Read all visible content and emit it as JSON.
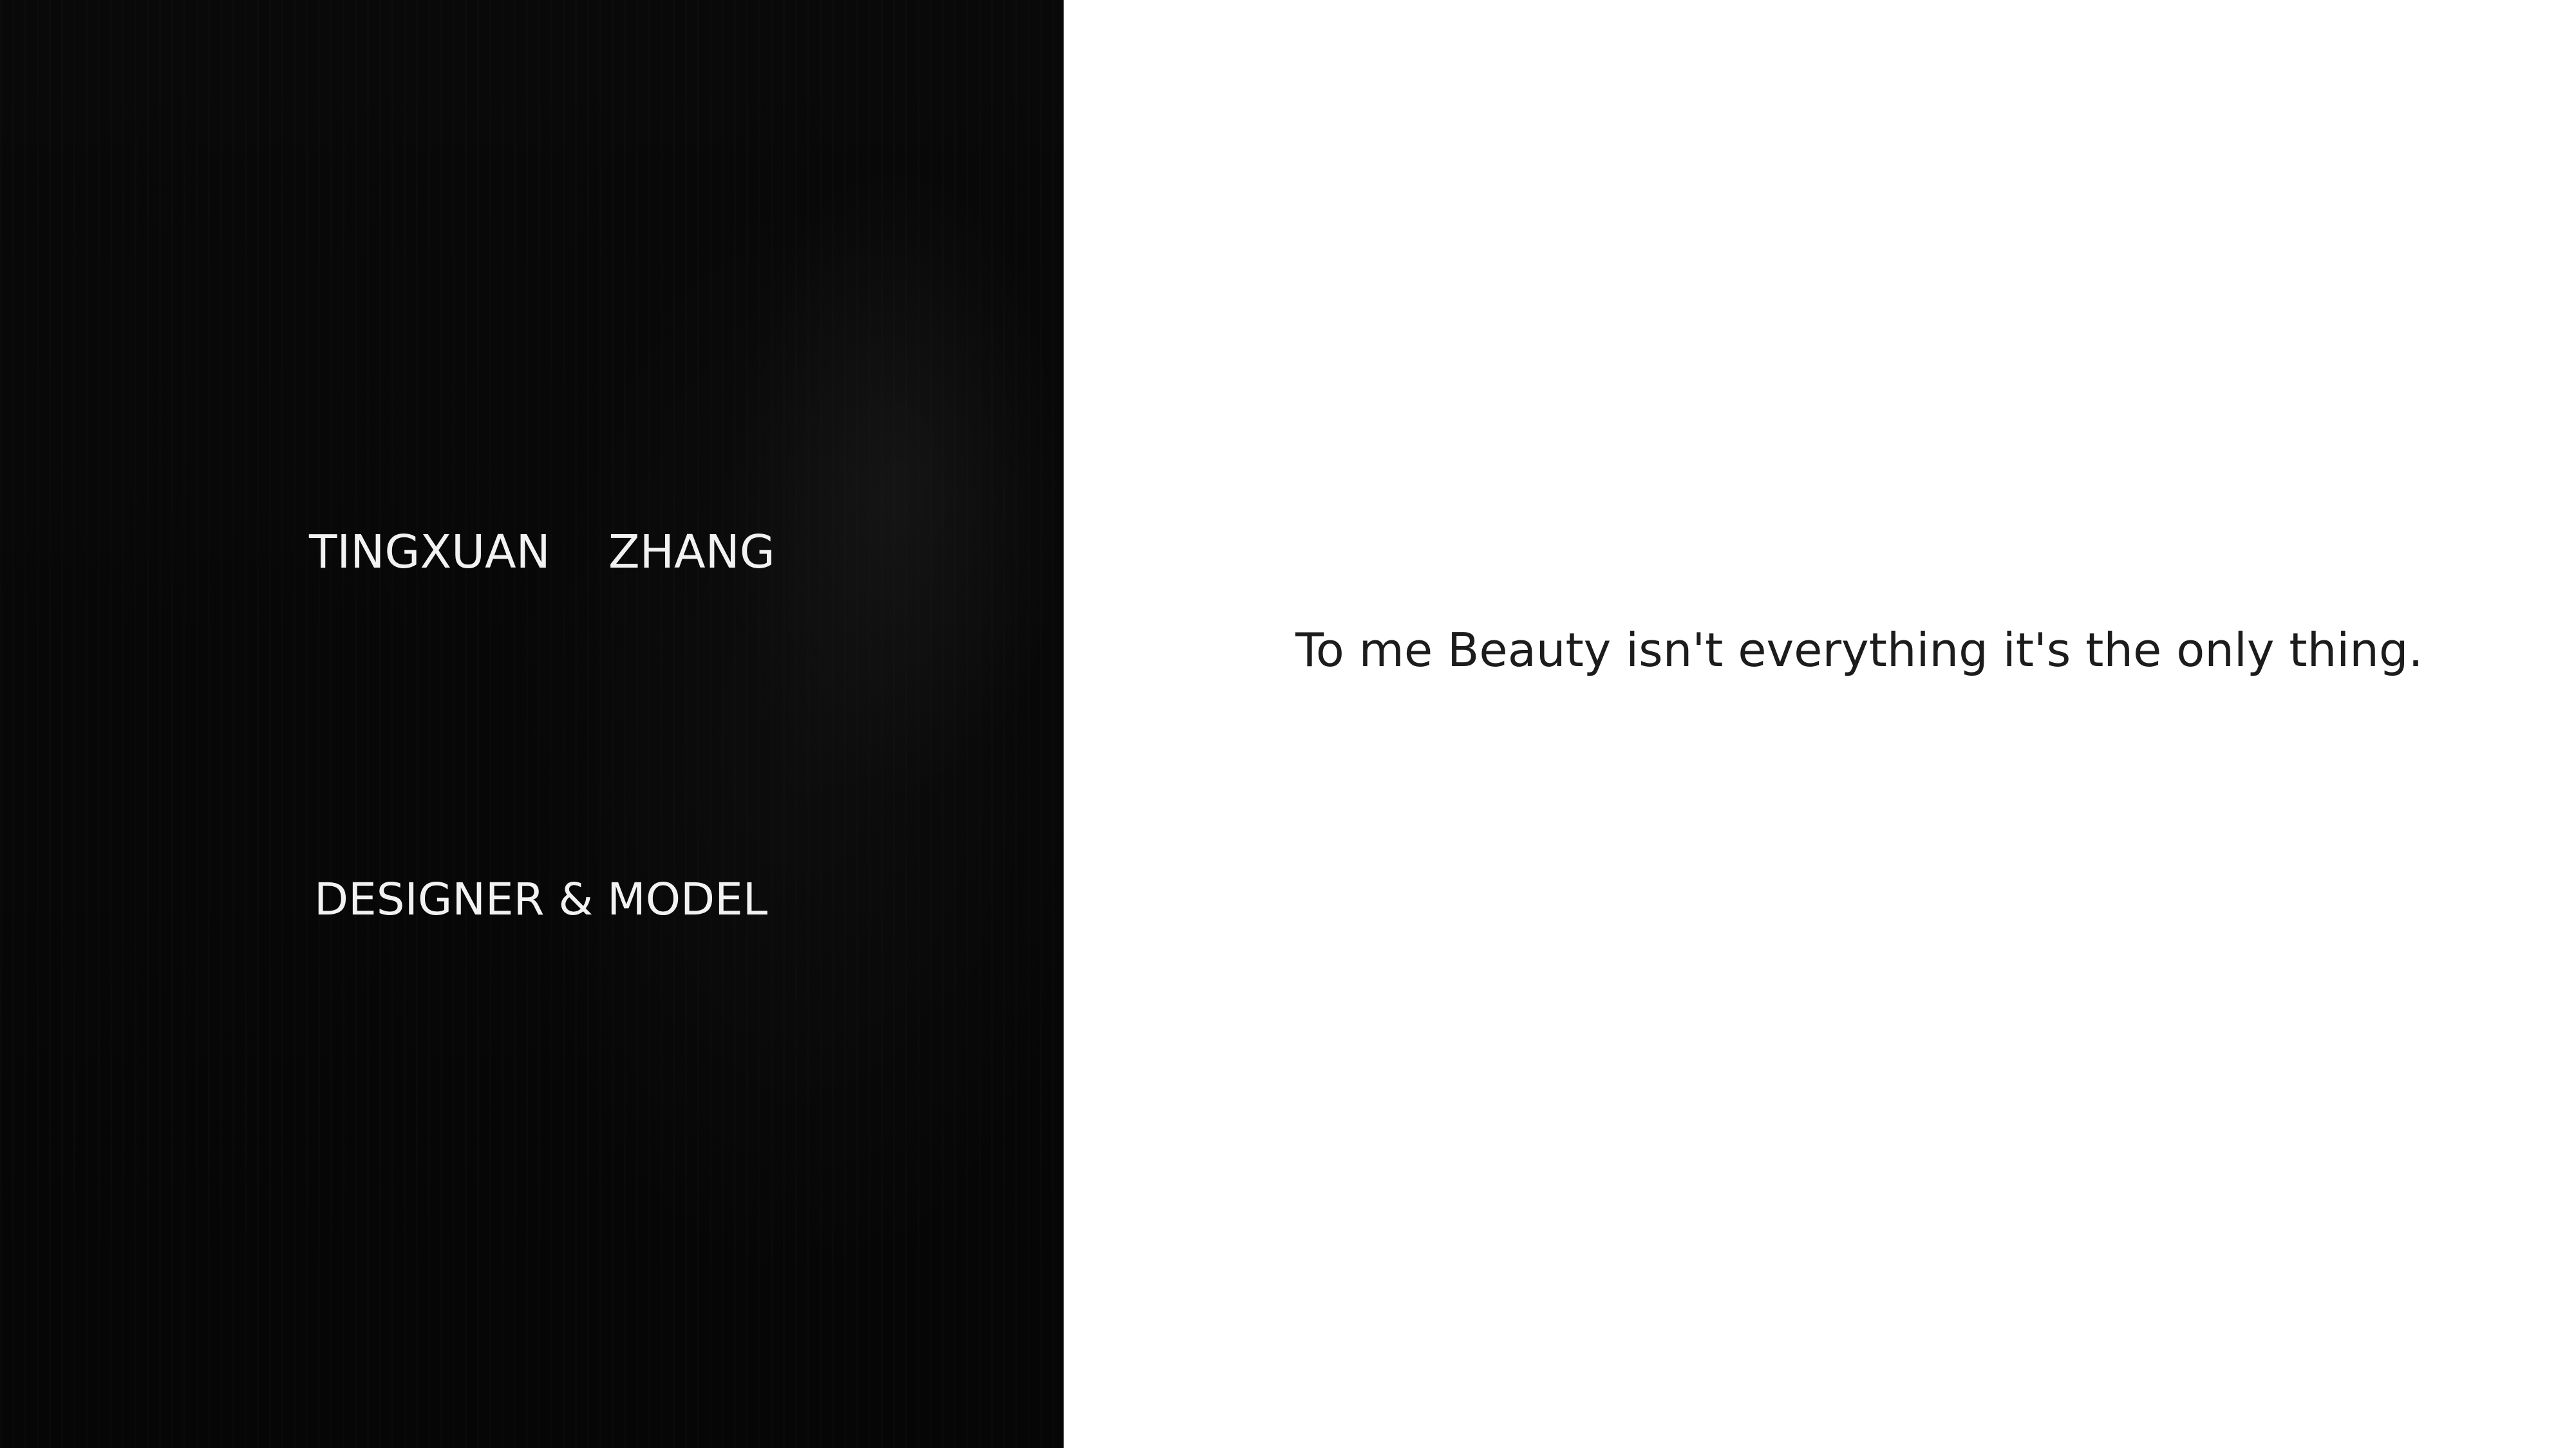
{
  "hero": {
    "name": "TINGXUAN    ZHANG",
    "role": "DESIGNER & MODEL"
  },
  "intro": {
    "quote": "To me Beauty isn't everything it's the only thing."
  },
  "colors": {
    "left_background": "#070707",
    "right_background": "#ffffff",
    "left_text": "#f2f2f2",
    "right_text": "#1c1c1c"
  }
}
